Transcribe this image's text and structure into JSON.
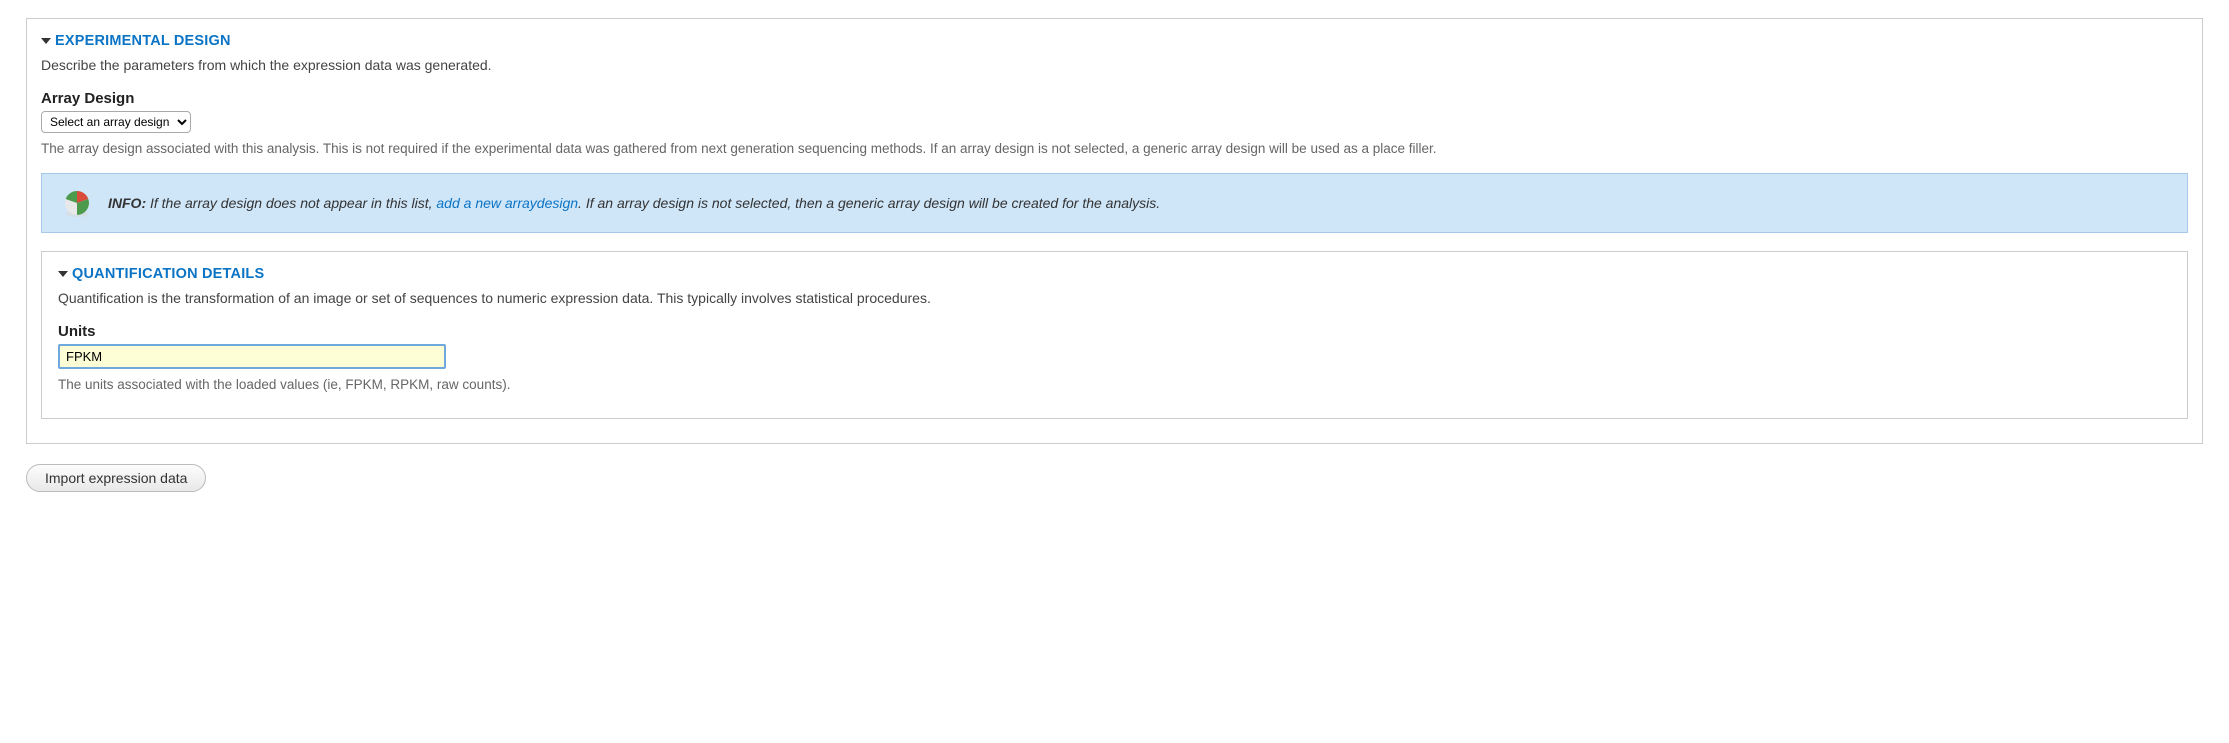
{
  "experimental_design": {
    "title": "EXPERIMENTAL DESIGN",
    "description": "Describe the parameters from which the expression data was generated.",
    "array_design": {
      "label": "Array Design",
      "selected": "Select an array design",
      "help": "The array design associated with this analysis. This is not required if the experimental data was gathered from next generation sequencing methods. If an array design is not selected, a generic array design will be used as a place filler."
    },
    "info": {
      "label": "INFO:",
      "text_before_link": " If the array design does not appear in this list, ",
      "link_text": "add a new arraydesign",
      "text_after_link": ". If an array design is not selected, then a generic array design will be created for the analysis."
    }
  },
  "quantification": {
    "title": "QUANTIFICATION DETAILS",
    "description": "Quantification is the transformation of an image or set of sequences to numeric expression data. This typically involves statistical procedures.",
    "units": {
      "label": "Units",
      "value": "FPKM",
      "help": "The units associated with the loaded values (ie, FPKM, RPKM, raw counts)."
    }
  },
  "submit": {
    "label": "Import expression data"
  }
}
